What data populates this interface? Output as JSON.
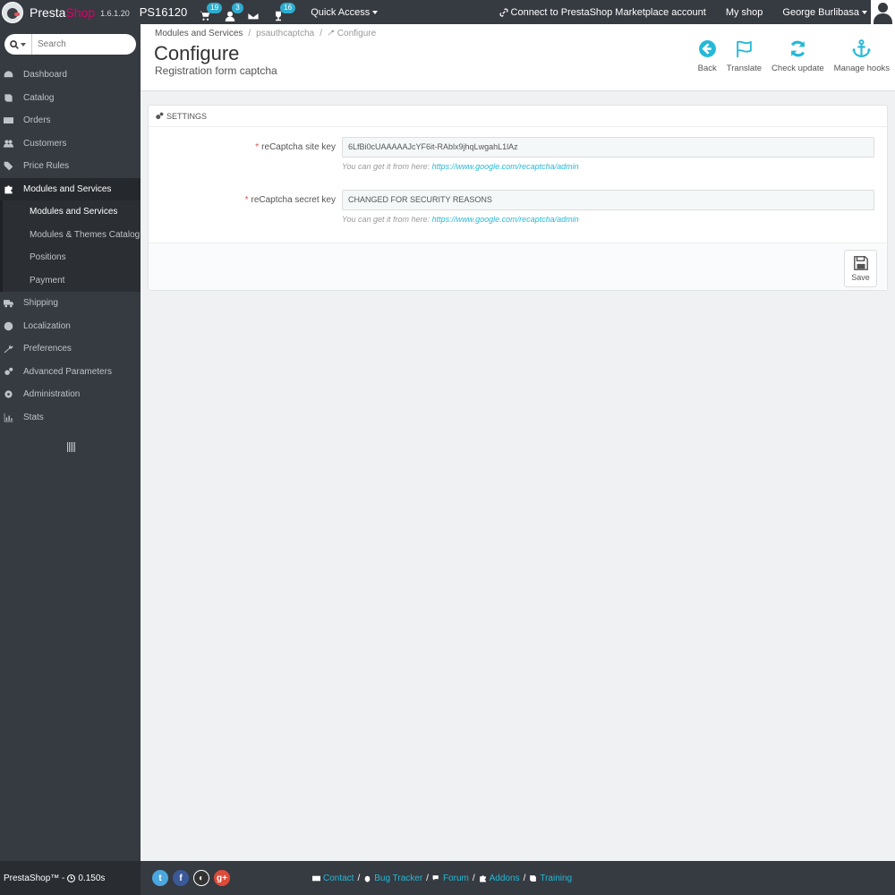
{
  "topbar": {
    "brand_presta": "Presta",
    "brand_shop": "Shop",
    "version": "1.6.1.20",
    "shop_name": "PS16120",
    "orders_count": "19",
    "customers_count": "3",
    "messages_count": "",
    "trophy_count": "16",
    "quick_access": "Quick Access",
    "marketplace": "Connect to PrestaShop Marketplace account",
    "my_shop": "My shop",
    "user": "George Burlibasa"
  },
  "sidebar": {
    "search_placeholder": "Search",
    "items": [
      {
        "label": "Dashboard",
        "icon": "dashboard-icon"
      },
      {
        "label": "Catalog",
        "icon": "book-icon"
      },
      {
        "label": "Orders",
        "icon": "credit-card-icon"
      },
      {
        "label": "Customers",
        "icon": "users-icon"
      },
      {
        "label": "Price Rules",
        "icon": "tags-icon"
      },
      {
        "label": "Modules and Services",
        "icon": "puzzle-icon"
      },
      {
        "label": "Shipping",
        "icon": "truck-icon"
      },
      {
        "label": "Localization",
        "icon": "globe-icon"
      },
      {
        "label": "Preferences",
        "icon": "wrench-icon"
      },
      {
        "label": "Advanced Parameters",
        "icon": "cogs-icon"
      },
      {
        "label": "Administration",
        "icon": "cog-icon"
      },
      {
        "label": "Stats",
        "icon": "bar-chart-icon"
      }
    ],
    "submenu": [
      {
        "label": "Modules and Services"
      },
      {
        "label": "Modules & Themes Catalog"
      },
      {
        "label": "Positions"
      },
      {
        "label": "Payment"
      }
    ]
  },
  "header": {
    "breadcrumb": [
      "Modules and Services",
      "psauthcaptcha",
      "Configure"
    ],
    "title": "Configure",
    "subtitle": "Registration form captcha",
    "toolbar": [
      {
        "label": "Back",
        "icon": "arrow-circle-left-icon"
      },
      {
        "label": "Translate",
        "icon": "flag-icon"
      },
      {
        "label": "Check update",
        "icon": "refresh-icon"
      },
      {
        "label": "Manage hooks",
        "icon": "anchor-icon"
      }
    ]
  },
  "panel": {
    "heading": "SETTINGS",
    "fields": [
      {
        "label": "reCaptcha site key",
        "value": "6LfBi0cUAAAAAJcYF6it-RAblx9jhqLwgahL1lAz",
        "help_text": "You can get it from here:",
        "help_link": "https://www.google.com/recaptcha/admin"
      },
      {
        "label": "reCaptcha secret key",
        "value": "CHANGED FOR SECURITY REASONS",
        "help_text": "You can get it from here:",
        "help_link": "https://www.google.com/recaptcha/admin"
      }
    ],
    "save_label": "Save"
  },
  "footer": {
    "brand": "PrestaShop™ -",
    "time": "0.150s",
    "links": [
      "Contact",
      "Bug Tracker",
      "Forum",
      "Addons",
      "Training"
    ]
  },
  "colors": {
    "accent": "#25b9d7",
    "dark": "#363a41",
    "required": "#d9534f"
  }
}
